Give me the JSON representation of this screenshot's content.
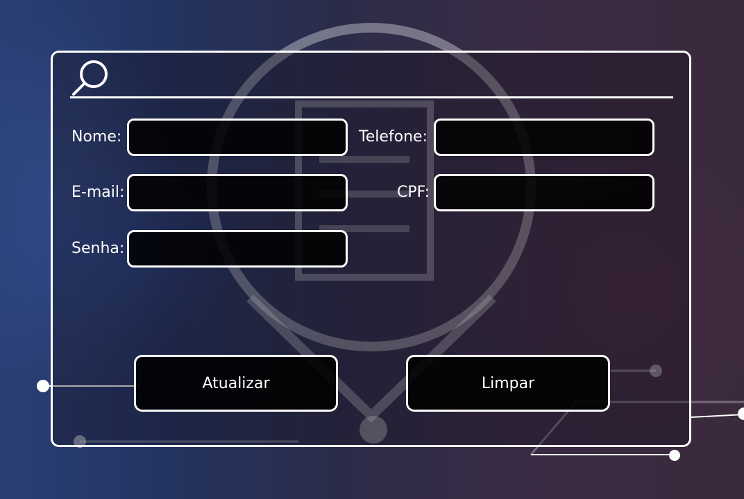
{
  "form": {
    "search_icon": "search-icon",
    "fields": {
      "nome": {
        "label": "Nome:",
        "value": "",
        "placeholder": ""
      },
      "telefone": {
        "label": "Telefone:",
        "value": "",
        "placeholder": ""
      },
      "email": {
        "label": "E-mail:",
        "value": "",
        "placeholder": ""
      },
      "cpf": {
        "label": "CPF:",
        "value": "",
        "placeholder": ""
      },
      "senha": {
        "label": "Senha:",
        "value": "",
        "placeholder": ""
      }
    },
    "buttons": {
      "atualizar": "Atualizar",
      "limpar": "Limpar"
    }
  },
  "colors": {
    "border": "#ffffff",
    "field_fill": "#000000",
    "text": "#ffffff"
  }
}
